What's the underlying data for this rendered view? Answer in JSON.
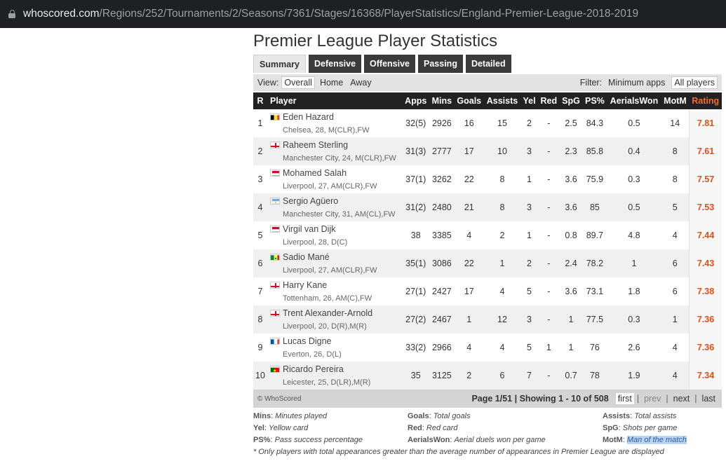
{
  "browser": {
    "host": "whoscored.com",
    "path": "/Regions/252/Tournaments/2/Seasons/7361/Stages/16368/PlayerStatistics/England-Premier-League-2018-2019"
  },
  "page": {
    "title": "Premier League Player Statistics"
  },
  "tabs": [
    "Summary",
    "Defensive",
    "Offensive",
    "Passing",
    "Detailed"
  ],
  "active_tab": "Summary",
  "view": {
    "label": "View:",
    "options": [
      "Overall",
      "Home",
      "Away"
    ],
    "selected": "Overall"
  },
  "filter": {
    "label": "Filter:",
    "options": [
      "Minimum apps",
      "All players"
    ],
    "selected": "All players"
  },
  "columns": {
    "r": "R",
    "player": "Player",
    "apps": "Apps",
    "mins": "Mins",
    "goals": "Goals",
    "assists": "Assists",
    "yel": "Yel",
    "red": "Red",
    "spg": "SpG",
    "ps": "PS%",
    "aerials": "AerialsWon",
    "motm": "MotM",
    "rating": "Rating"
  },
  "rows": [
    {
      "rank": "1",
      "name": "Eden Hazard",
      "meta": "Chelsea, 28, M(CLR),FW",
      "flag": "belgium-flag",
      "apps": "32(5)",
      "mins": "2926",
      "goals": "16",
      "assists": "15",
      "yel": "2",
      "red": "-",
      "spg": "2.5",
      "ps": "84.3",
      "aerials": "0.5",
      "motm": "14",
      "rating": "7.81"
    },
    {
      "rank": "2",
      "name": "Raheem Sterling",
      "meta": "Manchester City, 24, M(CLR),FW",
      "flag": "england-flag",
      "apps": "31(3)",
      "mins": "2777",
      "goals": "17",
      "assists": "10",
      "yel": "3",
      "red": "-",
      "spg": "2.3",
      "ps": "85.8",
      "aerials": "0.4",
      "motm": "8",
      "rating": "7.61"
    },
    {
      "rank": "3",
      "name": "Mohamed Salah",
      "meta": "Liverpool, 27, AM(CLR),FW",
      "flag": "egypt-flag",
      "apps": "37(1)",
      "mins": "3262",
      "goals": "22",
      "assists": "8",
      "yel": "1",
      "red": "-",
      "spg": "3.6",
      "ps": "75.9",
      "aerials": "0.3",
      "motm": "8",
      "rating": "7.57"
    },
    {
      "rank": "4",
      "name": "Sergio Agüero",
      "meta": "Manchester City, 31, AM(CL),FW",
      "flag": "argentina-flag",
      "apps": "31(2)",
      "mins": "2480",
      "goals": "21",
      "assists": "8",
      "yel": "3",
      "red": "-",
      "spg": "3.6",
      "ps": "85",
      "aerials": "0.5",
      "motm": "5",
      "rating": "7.53"
    },
    {
      "rank": "5",
      "name": "Virgil van Dijk",
      "meta": "Liverpool, 28, D(C)",
      "flag": "netherlands-flag",
      "apps": "38",
      "mins": "3385",
      "goals": "4",
      "assists": "2",
      "yel": "1",
      "red": "-",
      "spg": "0.8",
      "ps": "89.7",
      "aerials": "4.8",
      "motm": "4",
      "rating": "7.44"
    },
    {
      "rank": "6",
      "name": "Sadio Mané",
      "meta": "Liverpool, 27, AM(CLR),FW",
      "flag": "senegal-flag",
      "apps": "35(1)",
      "mins": "3086",
      "goals": "22",
      "assists": "1",
      "yel": "2",
      "red": "-",
      "spg": "2.4",
      "ps": "78.2",
      "aerials": "1",
      "motm": "6",
      "rating": "7.43"
    },
    {
      "rank": "7",
      "name": "Harry Kane",
      "meta": "Tottenham, 26, AM(C),FW",
      "flag": "england-flag",
      "apps": "27(1)",
      "mins": "2427",
      "goals": "17",
      "assists": "4",
      "yel": "5",
      "red": "-",
      "spg": "3.6",
      "ps": "73.1",
      "aerials": "1.8",
      "motm": "6",
      "rating": "7.38"
    },
    {
      "rank": "8",
      "name": "Trent Alexander-Arnold",
      "meta": "Liverpool, 20, D(R),M(R)",
      "flag": "england-flag",
      "apps": "27(2)",
      "mins": "2467",
      "goals": "1",
      "assists": "12",
      "yel": "3",
      "red": "-",
      "spg": "1",
      "ps": "77.5",
      "aerials": "0.3",
      "motm": "1",
      "rating": "7.36"
    },
    {
      "rank": "9",
      "name": "Lucas Digne",
      "meta": "Everton, 26, D(L)",
      "flag": "france-flag",
      "apps": "33(2)",
      "mins": "2966",
      "goals": "4",
      "assists": "4",
      "yel": "5",
      "red": "1",
      "spg": "1",
      "ps": "76",
      "aerials": "2.6",
      "motm": "4",
      "rating": "7.36"
    },
    {
      "rank": "10",
      "name": "Ricardo Pereira",
      "meta": "Leicester, 25, D(LR),M(R)",
      "flag": "portugal-flag",
      "apps": "35",
      "mins": "3125",
      "goals": "2",
      "assists": "6",
      "yel": "7",
      "red": "-",
      "spg": "0.7",
      "ps": "78",
      "aerials": "1.9",
      "motm": "4",
      "rating": "7.34"
    }
  ],
  "footer": {
    "copyright": "© WhoScored",
    "page_info": "Page 1/51 | Showing 1 - 10 of 508",
    "first": "first",
    "prev": "prev",
    "next": "next",
    "last": "last",
    "sep": "|"
  },
  "legend": [
    {
      "key": "Mins",
      "desc": "Minutes played"
    },
    {
      "key": "Goals",
      "desc": "Total goals"
    },
    {
      "key": "Assists",
      "desc": "Total assists"
    },
    {
      "key": "Yel",
      "desc": "Yellow card"
    },
    {
      "key": "Red",
      "desc": "Red card"
    },
    {
      "key": "SpG",
      "desc": "Shots per game"
    },
    {
      "key": "PS%",
      "desc": "Pass success percentage"
    },
    {
      "key": "AerialsWon",
      "desc": "Aerial duels won per game"
    },
    {
      "key": "MotM",
      "desc": "Man of the match"
    }
  ],
  "note": "* Only players with total appearances greater than the average number of appearances in Premier League are displayed",
  "colors": {
    "rating": "#e74c12",
    "header_bg": "#222222",
    "tab_bg": "#3a3a3a"
  }
}
